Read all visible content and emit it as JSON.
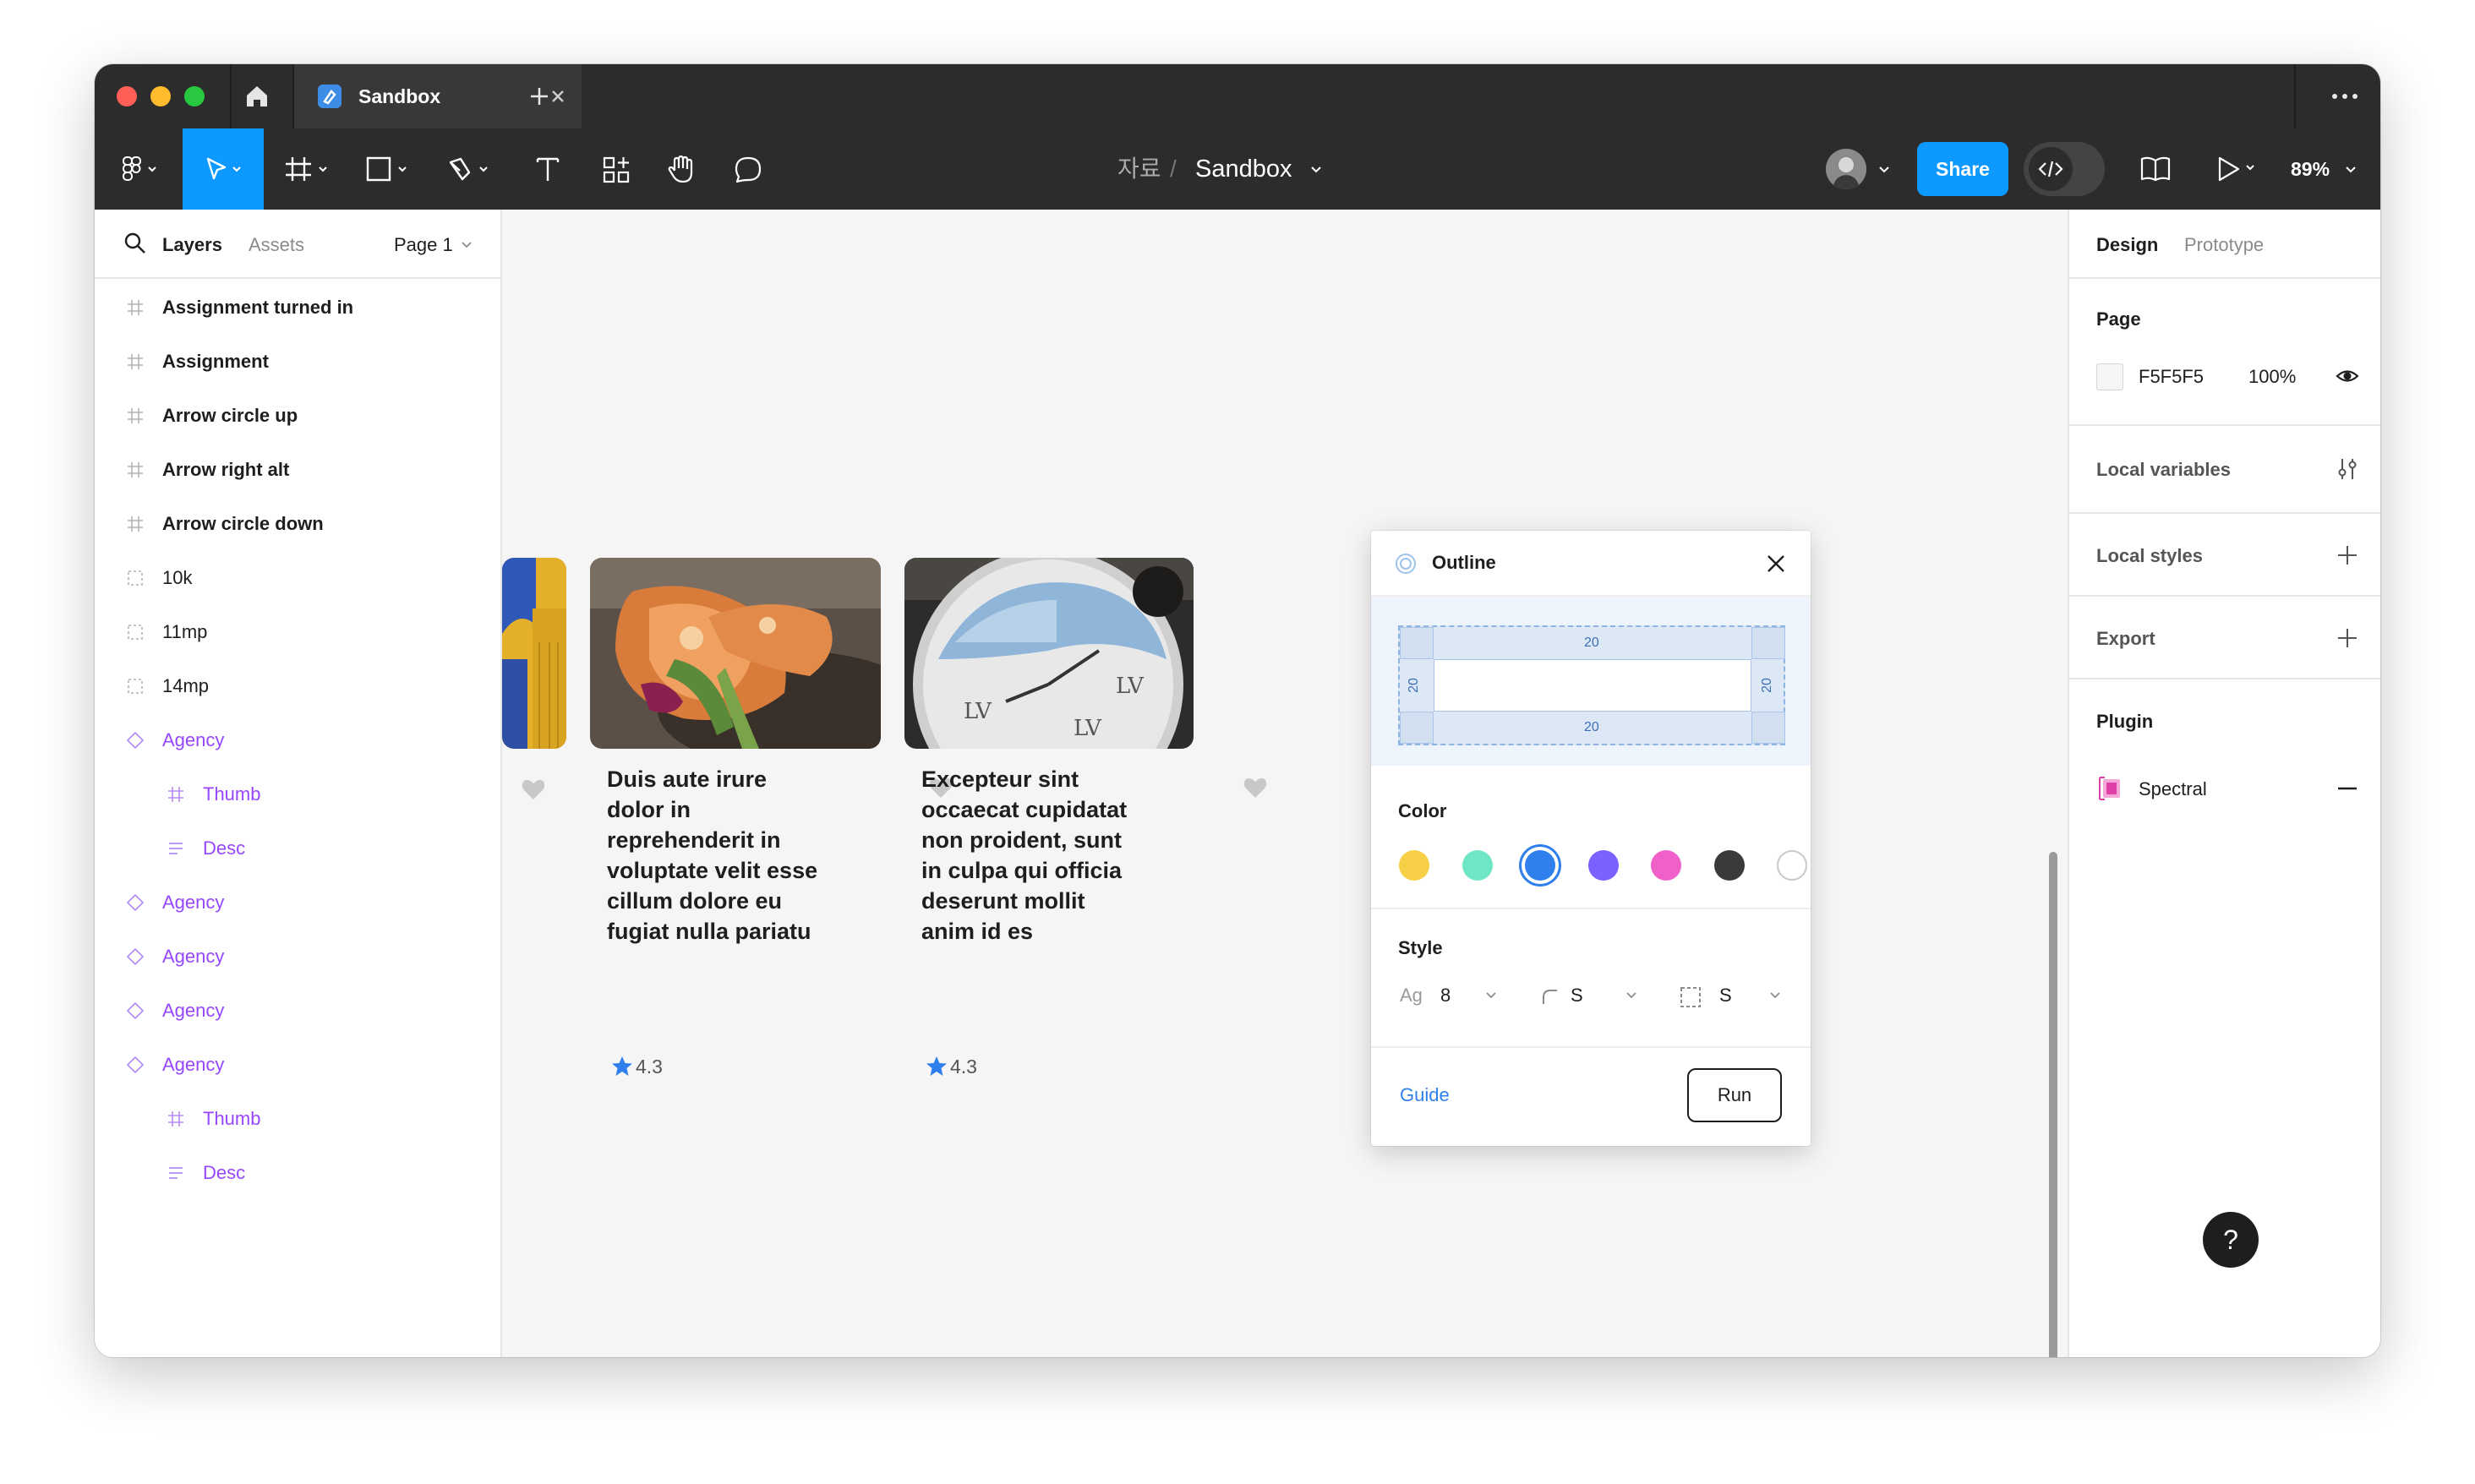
{
  "titlebar": {
    "tab_title": "Sandbox"
  },
  "toolbar": {
    "breadcrumb_folder": "자료",
    "breadcrumb_separator": "/",
    "file_name": "Sandbox",
    "share_label": "Share",
    "zoom": "89%"
  },
  "left_panel": {
    "tab_layers": "Layers",
    "tab_assets": "Assets",
    "page_selector": "Page 1",
    "layers": [
      {
        "name": "Assignment turned in",
        "type": "frame"
      },
      {
        "name": "Assignment",
        "type": "frame"
      },
      {
        "name": "Arrow circle up",
        "type": "frame"
      },
      {
        "name": "Arrow right alt",
        "type": "frame"
      },
      {
        "name": "Arrow circle down",
        "type": "frame"
      },
      {
        "name": "10k",
        "type": "section"
      },
      {
        "name": "11mp",
        "type": "section"
      },
      {
        "name": "14mp",
        "type": "section"
      },
      {
        "name": "Agency",
        "type": "component"
      },
      {
        "name": "Thumb",
        "type": "component-frame"
      },
      {
        "name": "Desc",
        "type": "component-text"
      },
      {
        "name": "Agency",
        "type": "component"
      },
      {
        "name": "Agency",
        "type": "component"
      },
      {
        "name": "Agency",
        "type": "component"
      },
      {
        "name": "Agency",
        "type": "component"
      },
      {
        "name": "Thumb",
        "type": "component-frame"
      },
      {
        "name": "Desc",
        "type": "component-text"
      }
    ]
  },
  "canvas": {
    "cards": [
      {
        "title": "",
        "rating": ""
      },
      {
        "title": "Duis aute irure dolor in reprehenderit in voluptate velit esse cillum dolore eu fugiat nulla pariatu",
        "rating": "4.3"
      },
      {
        "title": "Excepteur sint occaecat cupidatat non proident, sunt in culpa qui officia deserunt mollit anim id es",
        "rating": "4.3"
      }
    ]
  },
  "plugin_dialog": {
    "title": "Outline",
    "padding_top": "20",
    "padding_bottom": "20",
    "padding_left": "20",
    "padding_right": "20",
    "color_label": "Color",
    "colors": [
      "#f7cf46",
      "#6ee7c6",
      "#2f80ed",
      "#7b61ff",
      "#f060c9",
      "#3a3a3a",
      "#ffffff"
    ],
    "selected_color_index": 2,
    "style_label": "Style",
    "style_ag_label": "Ag",
    "style_font_size": "8",
    "style_radius": "S",
    "style_border": "S",
    "guide_label": "Guide",
    "run_label": "Run"
  },
  "right_panel": {
    "tab_design": "Design",
    "tab_prototype": "Prototype",
    "page_label": "Page",
    "page_color_hex": "F5F5F5",
    "page_opacity": "100%",
    "local_variables_label": "Local variables",
    "local_styles_label": "Local styles",
    "export_label": "Export",
    "plugin_label": "Plugin",
    "plugin_name": "Spectral"
  },
  "help_label": "?"
}
